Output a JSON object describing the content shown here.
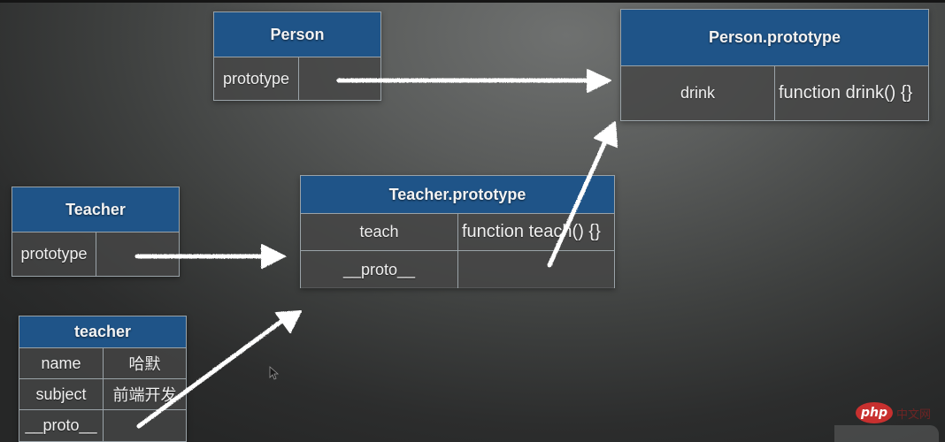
{
  "diagram": {
    "person": {
      "title": "Person",
      "rows": [
        {
          "key": "prototype",
          "value": ""
        }
      ]
    },
    "person_prototype": {
      "title": "Person.prototype",
      "rows": [
        {
          "key": "drink",
          "value": "function drink() {}"
        }
      ]
    },
    "teacher": {
      "title": "Teacher",
      "rows": [
        {
          "key": "prototype",
          "value": ""
        }
      ]
    },
    "teacher_prototype": {
      "title": "Teacher.prototype",
      "rows": [
        {
          "key": "teach",
          "value": "function teach() {}"
        },
        {
          "key": "__proto__",
          "value": ""
        }
      ]
    },
    "teacher_instance": {
      "title": "teacher",
      "rows": [
        {
          "key": "name",
          "value": "哈默"
        },
        {
          "key": "subject",
          "value": "前端开发"
        },
        {
          "key": "__proto__",
          "value": ""
        }
      ]
    },
    "arrows": [
      {
        "from": "Person.prototype",
        "to": "Person.prototype box"
      },
      {
        "from": "Teacher.prototype",
        "to": "Teacher.prototype box"
      },
      {
        "from": "teacher.__proto__",
        "to": "Teacher.prototype box"
      },
      {
        "from": "Teacher.prototype.__proto__",
        "to": "Person.prototype box"
      }
    ]
  },
  "colors": {
    "header_blue": "#1f5488",
    "arrow": "#ffffff"
  },
  "watermark": {
    "logo": "php",
    "text": "中文网"
  }
}
